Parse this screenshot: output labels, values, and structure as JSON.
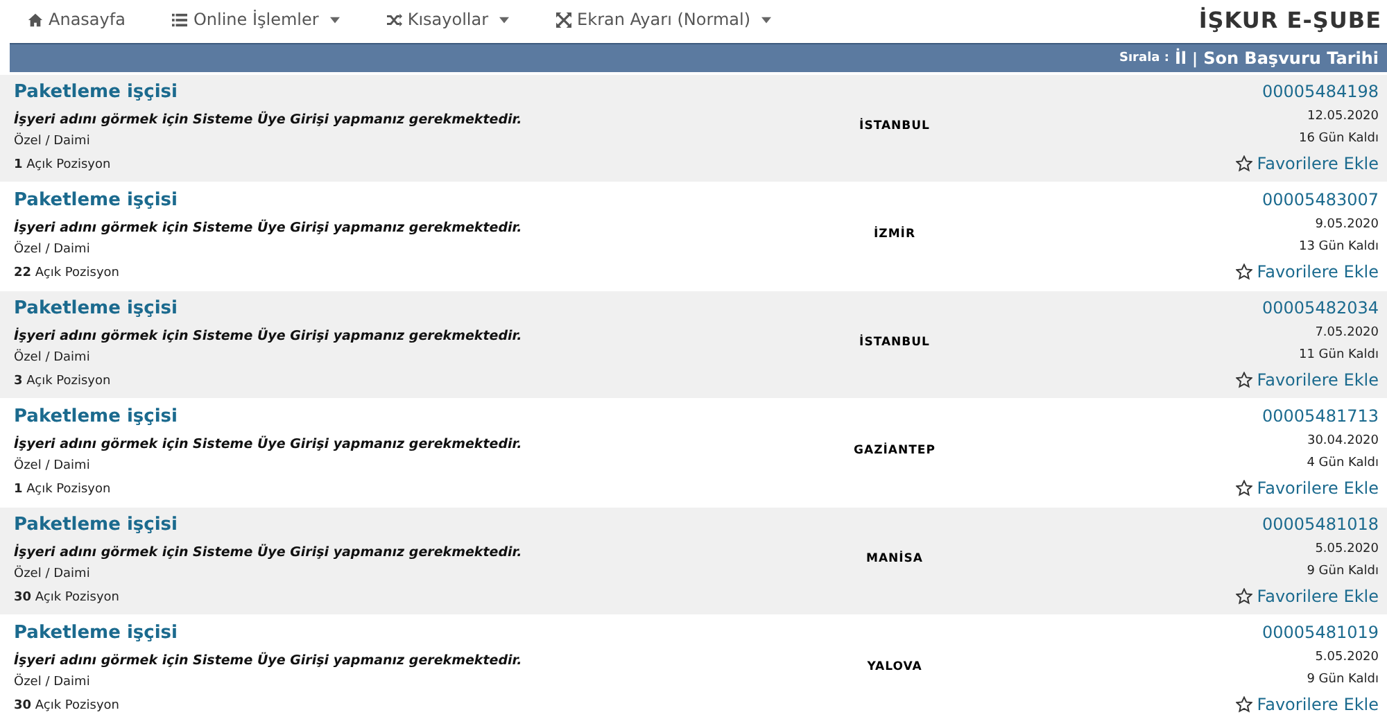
{
  "nav": [
    {
      "label": "Anasayfa",
      "kind": "home",
      "dropdown": false
    },
    {
      "label": "Online İşlemler",
      "kind": "list",
      "dropdown": true
    },
    {
      "label": "Kısayollar",
      "kind": "shuffle",
      "dropdown": true
    },
    {
      "label": "Ekran Ayarı (Normal)",
      "kind": "expand",
      "dropdown": true
    }
  ],
  "brand": "İŞKUR E-ŞUBE",
  "sort": {
    "label": "Sırala :",
    "options": [
      "İl",
      "Son Başvuru Tarihi"
    ],
    "separator": "|"
  },
  "jobs": [
    {
      "title": "Paketleme işçisi",
      "notice": "İşyeri adını görmek için Sisteme Üye Girişi yapmanız gerekmektedir.",
      "type": "Özel / Daimi",
      "count": "1",
      "positions": "Açık Pozisyon",
      "city": "İSTANBUL",
      "id": "00005484198",
      "date": "12.05.2020",
      "remaining": "16 Gün Kaldı",
      "fav": "Favorilere Ekle"
    },
    {
      "title": "Paketleme işçisi",
      "notice": "İşyeri adını görmek için Sisteme Üye Girişi yapmanız gerekmektedir.",
      "type": "Özel / Daimi",
      "count": "22",
      "positions": "Açık Pozisyon",
      "city": "İZMİR",
      "id": "00005483007",
      "date": "9.05.2020",
      "remaining": "13 Gün Kaldı",
      "fav": "Favorilere Ekle"
    },
    {
      "title": "Paketleme işçisi",
      "notice": "İşyeri adını görmek için Sisteme Üye Girişi yapmanız gerekmektedir.",
      "type": "Özel / Daimi",
      "count": "3",
      "positions": "Açık Pozisyon",
      "city": "İSTANBUL",
      "id": "00005482034",
      "date": "7.05.2020",
      "remaining": "11 Gün Kaldı",
      "fav": "Favorilere Ekle"
    },
    {
      "title": "Paketleme işçisi",
      "notice": "İşyeri adını görmek için Sisteme Üye Girişi yapmanız gerekmektedir.",
      "type": "Özel / Daimi",
      "count": "1",
      "positions": "Açık Pozisyon",
      "city": "GAZİANTEP",
      "id": "00005481713",
      "date": "30.04.2020",
      "remaining": "4 Gün Kaldı",
      "fav": "Favorilere Ekle"
    },
    {
      "title": "Paketleme işçisi",
      "notice": "İşyeri adını görmek için Sisteme Üye Girişi yapmanız gerekmektedir.",
      "type": "Özel / Daimi",
      "count": "30",
      "positions": "Açık Pozisyon",
      "city": "MANİSA",
      "id": "00005481018",
      "date": "5.05.2020",
      "remaining": "9 Gün Kaldı",
      "fav": "Favorilere Ekle"
    },
    {
      "title": "Paketleme işçisi",
      "notice": "İşyeri adını görmek için Sisteme Üye Girişi yapmanız gerekmektedir.",
      "type": "Özel / Daimi",
      "count": "30",
      "positions": "Açık Pozisyon",
      "city": "YALOVA",
      "id": "00005481019",
      "date": "5.05.2020",
      "remaining": "9 Gün Kaldı",
      "fav": "Favorilere Ekle"
    }
  ]
}
